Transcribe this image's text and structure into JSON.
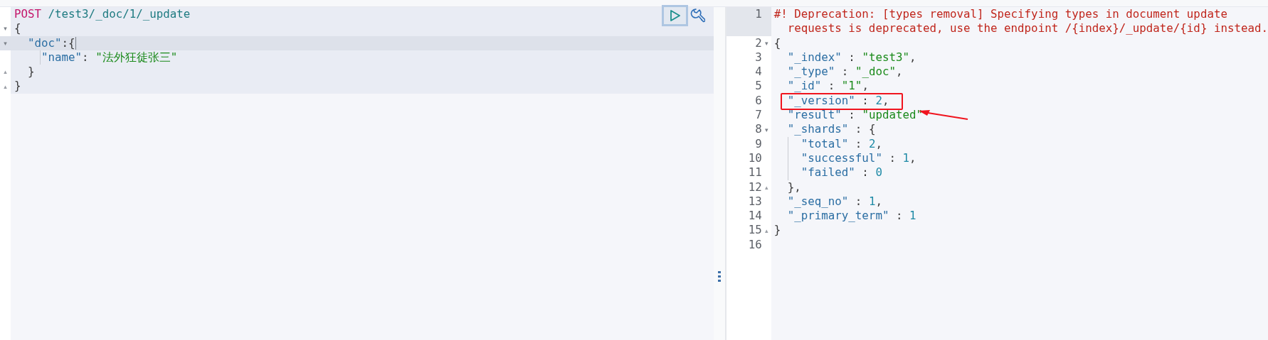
{
  "request_editor": {
    "lines": [
      {
        "active": false,
        "guide": false,
        "tokens": [
          {
            "kind": "method",
            "text": "POST"
          },
          {
            "kind": "path",
            "text": " /test3/_doc/1/_update"
          }
        ]
      },
      {
        "fold_marker": "▾",
        "active": false,
        "guide": false,
        "tokens": [
          {
            "kind": "punct",
            "text": "{"
          }
        ]
      },
      {
        "fold_marker": "▾",
        "active": true,
        "guide": false,
        "tokens": [
          {
            "kind": "key",
            "text": "  \"doc\""
          },
          {
            "kind": "punct",
            "text": ":{"
          }
        ]
      },
      {
        "active": false,
        "guide": true,
        "tokens": [
          {
            "kind": "key",
            "text": "    \"name\""
          },
          {
            "kind": "punct",
            "text": ": "
          },
          {
            "kind": "string",
            "text": "\"法外狂徒张三\""
          }
        ]
      },
      {
        "fold_marker": "▴",
        "active": false,
        "guide": false,
        "tokens": [
          {
            "kind": "punct",
            "text": "  }"
          }
        ]
      },
      {
        "fold_marker": "▴",
        "active": false,
        "guide": false,
        "tokens": [
          {
            "kind": "punct",
            "text": "}"
          }
        ]
      }
    ]
  },
  "response_viewer": {
    "lines": [
      {
        "number": "1",
        "active": true,
        "tokens": [
          {
            "kind": "comment",
            "text": "#! Deprecation: [types removal] Specifying types in document update"
          }
        ]
      },
      {
        "active": true,
        "tokens": [
          {
            "kind": "comment",
            "text": "  requests is deprecated, use the endpoint /{index}/_update/{id} instead."
          }
        ]
      },
      {
        "number": "2",
        "active": false,
        "fold_marker": "▾",
        "tokens": [
          {
            "kind": "punct",
            "text": "{"
          }
        ]
      },
      {
        "number": "3",
        "active": false,
        "tokens": [
          {
            "kind": "key",
            "text": "  \"_index\""
          },
          {
            "kind": "punct",
            "text": " : "
          },
          {
            "kind": "string",
            "text": "\"test3\""
          },
          {
            "kind": "punct",
            "text": ","
          }
        ]
      },
      {
        "number": "4",
        "active": false,
        "tokens": [
          {
            "kind": "key",
            "text": "  \"_type\""
          },
          {
            "kind": "punct",
            "text": " : "
          },
          {
            "kind": "string",
            "text": "\"_doc\""
          },
          {
            "kind": "punct",
            "text": ","
          }
        ]
      },
      {
        "number": "5",
        "active": false,
        "tokens": [
          {
            "kind": "key",
            "text": "  \"_id\""
          },
          {
            "kind": "punct",
            "text": " : "
          },
          {
            "kind": "string",
            "text": "\"1\""
          },
          {
            "kind": "punct",
            "text": ","
          }
        ]
      },
      {
        "number": "6",
        "active": false,
        "highlighted": true,
        "tokens": [
          {
            "kind": "key",
            "text": "  \"_version\""
          },
          {
            "kind": "punct",
            "text": " : "
          },
          {
            "kind": "number",
            "text": "2"
          },
          {
            "kind": "punct",
            "text": ","
          }
        ]
      },
      {
        "number": "7",
        "active": false,
        "pointer": true,
        "tokens": [
          {
            "kind": "key",
            "text": "  \"result\""
          },
          {
            "kind": "punct",
            "text": " : "
          },
          {
            "kind": "string",
            "text": "\"updated\""
          }
        ]
      },
      {
        "number": "8",
        "active": false,
        "fold_marker": "▾",
        "tokens": [
          {
            "kind": "key",
            "text": "  \"_shards\""
          },
          {
            "kind": "punct",
            "text": " : {"
          }
        ]
      },
      {
        "number": "9",
        "active": false,
        "guide": true,
        "tokens": [
          {
            "kind": "key",
            "text": "    \"total\""
          },
          {
            "kind": "punct",
            "text": " : "
          },
          {
            "kind": "number",
            "text": "2"
          },
          {
            "kind": "punct",
            "text": ","
          }
        ]
      },
      {
        "number": "10",
        "active": false,
        "guide": true,
        "tokens": [
          {
            "kind": "key",
            "text": "    \"successful\""
          },
          {
            "kind": "punct",
            "text": " : "
          },
          {
            "kind": "number",
            "text": "1"
          },
          {
            "kind": "punct",
            "text": ","
          }
        ]
      },
      {
        "number": "11",
        "active": false,
        "guide": true,
        "tokens": [
          {
            "kind": "key",
            "text": "    \"failed\""
          },
          {
            "kind": "punct",
            "text": " : "
          },
          {
            "kind": "number",
            "text": "0"
          }
        ]
      },
      {
        "number": "12",
        "active": false,
        "fold_marker": "▴",
        "tokens": [
          {
            "kind": "punct",
            "text": "  },"
          }
        ]
      },
      {
        "number": "13",
        "active": false,
        "tokens": [
          {
            "kind": "key",
            "text": "  \"_seq_no\""
          },
          {
            "kind": "punct",
            "text": " : "
          },
          {
            "kind": "number",
            "text": "1"
          },
          {
            "kind": "punct",
            "text": ","
          }
        ]
      },
      {
        "number": "14",
        "active": false,
        "tokens": [
          {
            "kind": "key",
            "text": "  \"_primary_term\""
          },
          {
            "kind": "punct",
            "text": " : "
          },
          {
            "kind": "number",
            "text": "1"
          }
        ]
      },
      {
        "number": "15",
        "active": false,
        "fold_marker": "▴",
        "tokens": [
          {
            "kind": "punct",
            "text": "}"
          }
        ]
      },
      {
        "number": "16",
        "active": false
      }
    ]
  }
}
